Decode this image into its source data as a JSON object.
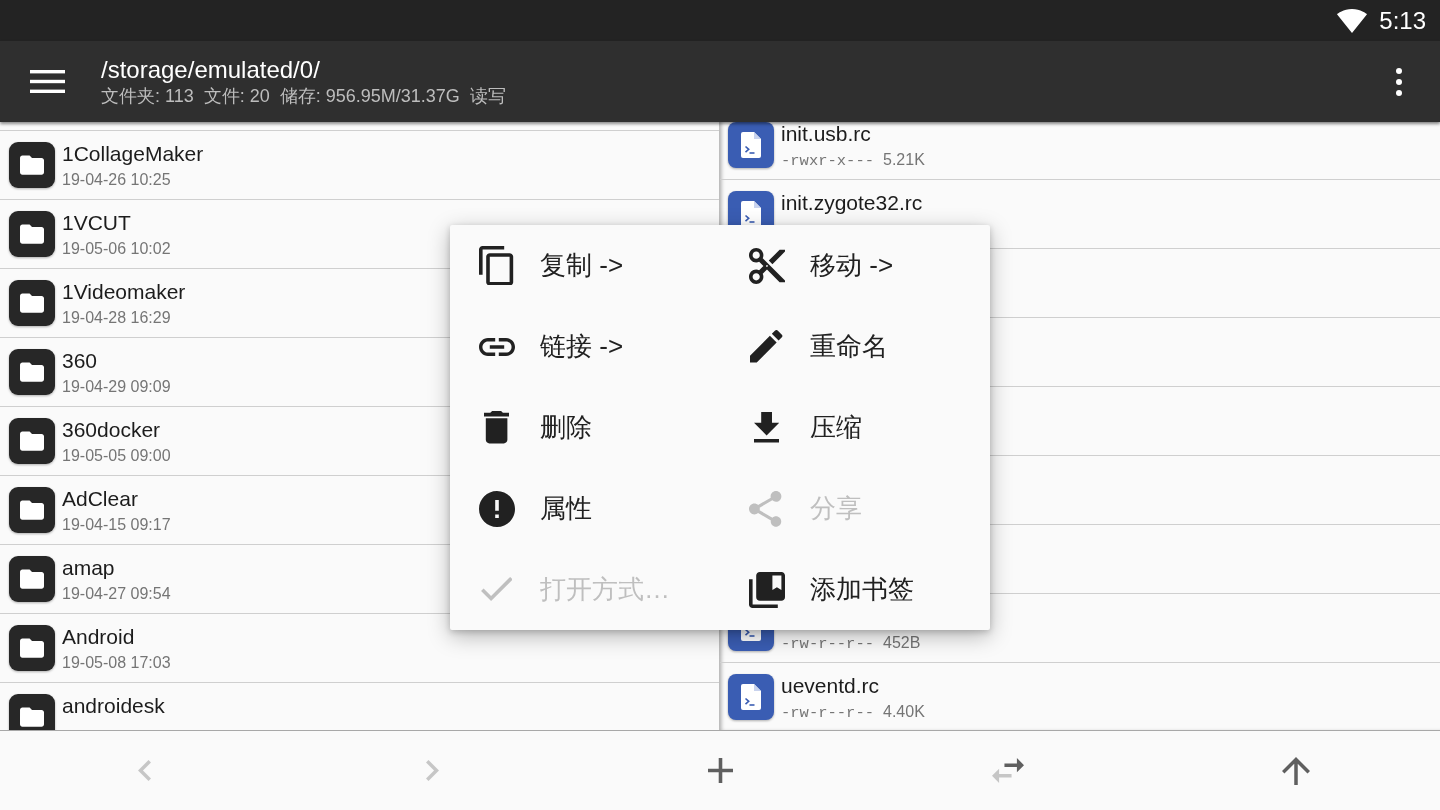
{
  "status_bar": {
    "time": "5:13"
  },
  "app_bar": {
    "title": "/storage/emulated/0/",
    "subtitle": "文件夹: 113  文件: 20  储存: 956.95M/31.37G  读写"
  },
  "left_pane": {
    "rows": [
      {
        "name": "1CollageMaker",
        "date": "19-04-26 10:25"
      },
      {
        "name": "1VCUT",
        "date": "19-05-06 10:02"
      },
      {
        "name": "1Videomaker",
        "date": "19-04-28 16:29"
      },
      {
        "name": "360",
        "date": "19-04-29 09:09"
      },
      {
        "name": "360docker",
        "date": "19-05-05 09:00"
      },
      {
        "name": "AdClear",
        "date": "19-04-15 09:17"
      },
      {
        "name": "amap",
        "date": "19-04-27 09:54"
      },
      {
        "name": "Android",
        "date": "19-05-08 17:03"
      },
      {
        "name": "androidesk"
      }
    ]
  },
  "right_pane": {
    "rows": [
      {
        "kind": "file",
        "name": "init.usb.rc",
        "perms": "-rwxr-x---",
        "size": "5.21K"
      },
      {
        "kind": "file",
        "name": "init.zygote32.rc"
      },
      {
        "kind": "covered"
      },
      {
        "kind": "covered"
      },
      {
        "kind": "covered"
      },
      {
        "kind": "covered"
      },
      {
        "kind": "covered"
      },
      {
        "kind": "file",
        "perms": "-rw-r--r--",
        "size": "452B"
      },
      {
        "kind": "file",
        "name": "ueventd.rc",
        "perms": "-rw-r--r--",
        "size": "4.40K"
      }
    ]
  },
  "context_menu": {
    "items": [
      {
        "label": "复制 ->",
        "disabled": false
      },
      {
        "label": "移动 ->",
        "disabled": false
      },
      {
        "label": "链接 ->",
        "disabled": false
      },
      {
        "label": "重命名",
        "disabled": false
      },
      {
        "label": "删除",
        "disabled": false
      },
      {
        "label": "压缩",
        "disabled": false
      },
      {
        "label": "属性",
        "disabled": false
      },
      {
        "label": "分享",
        "disabled": true
      },
      {
        "label": "打开方式…",
        "disabled": true
      },
      {
        "label": "添加书签",
        "disabled": false
      }
    ]
  },
  "bottom_toolbar": {
    "buttons": [
      {
        "disabled": true
      },
      {
        "disabled": true
      },
      {
        "disabled": false
      },
      {
        "disabled": false
      },
      {
        "disabled": false
      }
    ]
  }
}
